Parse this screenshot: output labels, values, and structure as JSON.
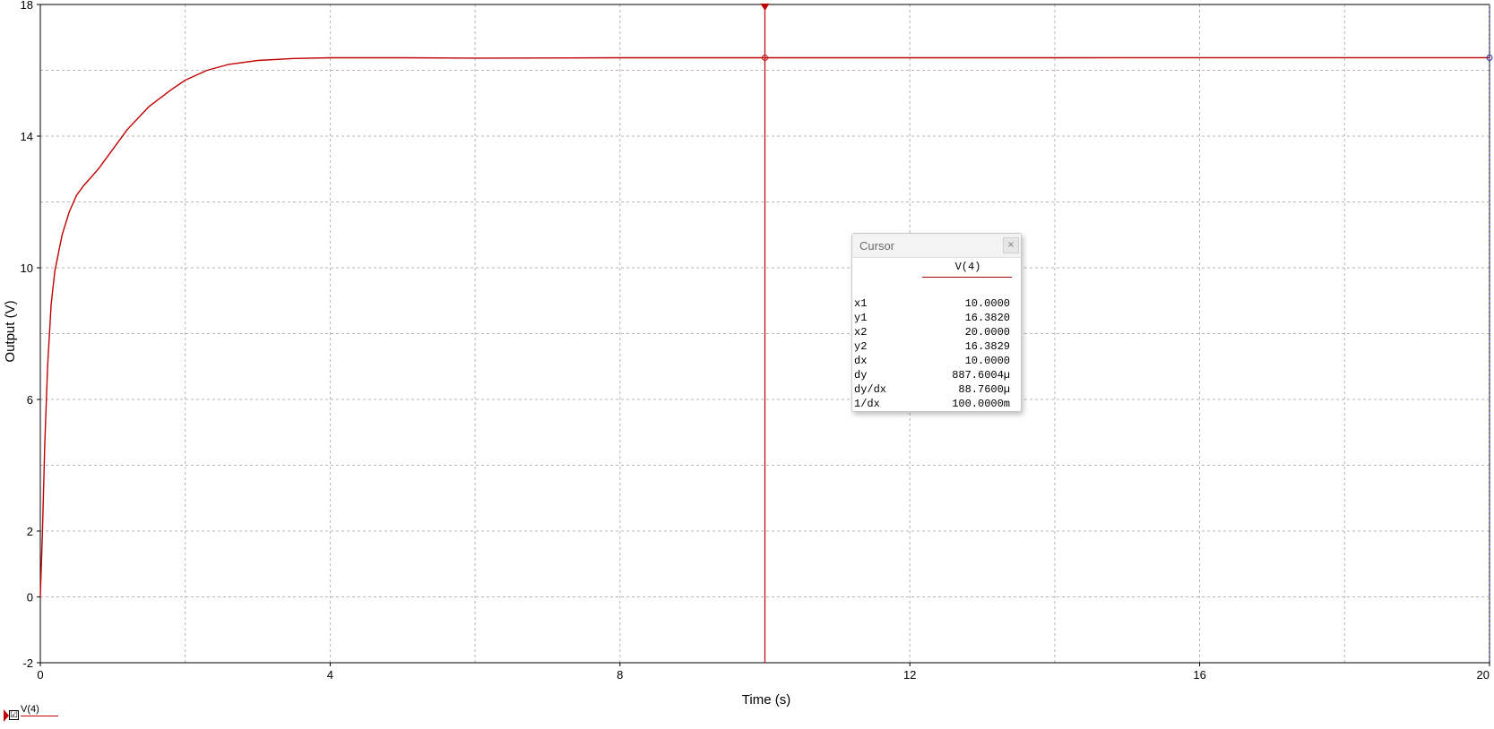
{
  "chart_data": {
    "type": "line",
    "xlabel": "Time (s)",
    "ylabel": "Output (V)",
    "xlim": [
      0,
      20
    ],
    "ylim": [
      -2,
      18
    ],
    "xticks": [
      0,
      4,
      8,
      12,
      16,
      20
    ],
    "yticks": [
      -2,
      0,
      2,
      6,
      10,
      14,
      18
    ],
    "x_gridlines": [
      0,
      2,
      4,
      6,
      8,
      10,
      12,
      14,
      16,
      18,
      20
    ],
    "y_gridlines": [
      -2,
      0,
      2,
      4,
      6,
      8,
      10,
      12,
      14,
      16,
      18
    ],
    "grid": true,
    "series": [
      {
        "name": "V(4)",
        "color": "#c00000",
        "x": [
          0,
          0.03,
          0.06,
          0.1,
          0.15,
          0.2,
          0.3,
          0.4,
          0.5,
          0.6,
          0.8,
          1.0,
          1.2,
          1.5,
          1.8,
          2.0,
          2.3,
          2.6,
          3.0,
          3.5,
          4.0,
          5.0,
          6.0,
          8.0,
          10.0,
          12.0,
          14.0,
          16.0,
          18.0,
          20.0
        ],
        "y": [
          0,
          2.0,
          4.6,
          7.0,
          8.9,
          9.9,
          11.0,
          11.7,
          12.2,
          12.5,
          13.0,
          13.6,
          14.2,
          14.9,
          15.4,
          15.7,
          16.0,
          16.18,
          16.3,
          16.36,
          16.38,
          16.38,
          16.37,
          16.38,
          16.382,
          16.382,
          16.382,
          16.383,
          16.383,
          16.3829
        ]
      }
    ],
    "cursors": [
      {
        "x": 10.0,
        "y": 16.382,
        "color": "#c00000"
      },
      {
        "x": 20.0,
        "y": 16.3829,
        "color": "#2a2aa8"
      }
    ]
  },
  "cursor_panel": {
    "title": "Cursor",
    "close_label": "×",
    "series_name": "V(4)",
    "rows": [
      {
        "label": "x1",
        "value": "10.0000"
      },
      {
        "label": "y1",
        "value": "16.3820"
      },
      {
        "label": "x2",
        "value": "20.0000"
      },
      {
        "label": "y2",
        "value": "16.3829"
      },
      {
        "label": "dx",
        "value": "10.0000"
      },
      {
        "label": "dy",
        "value": "887.6004µ"
      },
      {
        "label": "dy/dx",
        "value": "88.7600µ"
      },
      {
        "label": "1/dx",
        "value": "100.0000m"
      }
    ]
  },
  "legend": {
    "label": "V(4)",
    "checked": true,
    "checkmark": "☑",
    "color": "#c00000"
  }
}
